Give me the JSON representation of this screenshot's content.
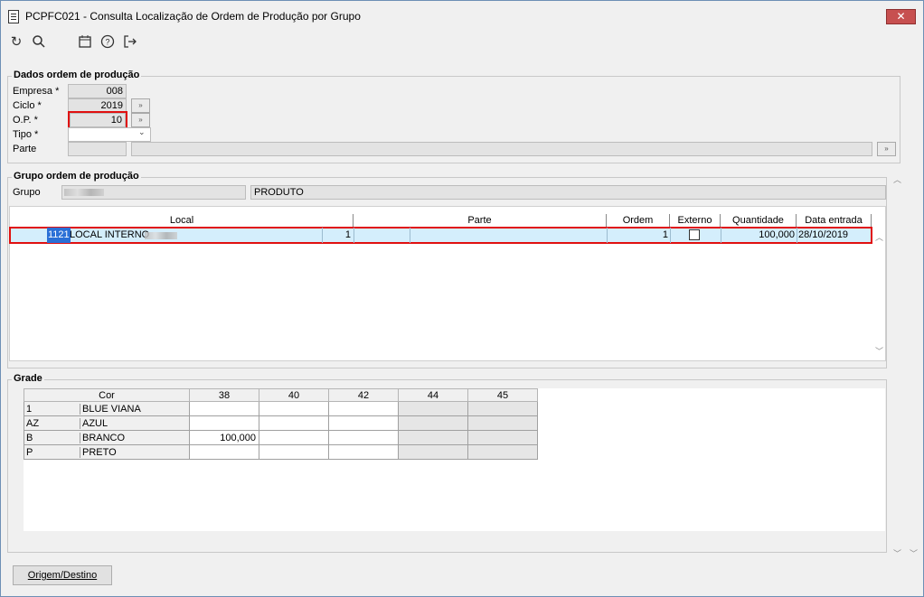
{
  "window": {
    "title": "PCPFC021 - Consulta Localização de Ordem de Produção por Grupo",
    "close_glyph": "✕"
  },
  "toolbar": {
    "refresh_glyph": "↻",
    "search_glyph": "🔍",
    "calendar_glyph": "▦",
    "help_glyph": "?",
    "exit_glyph": "⇥"
  },
  "dados": {
    "legend": "Dados ordem de produção",
    "empresa_label": "Empresa *",
    "empresa_value": "008",
    "ciclo_label": "Ciclo *",
    "ciclo_value": "2019",
    "op_label": "O.P. *",
    "op_value": "10",
    "tipo_label": "Tipo *",
    "tipo_value": "",
    "parte_label": "Parte",
    "parte_value": "",
    "parte_desc": "",
    "lookup_glyph": "»"
  },
  "grupo": {
    "legend": "Grupo ordem de produção",
    "grupo_label": "Grupo",
    "grupo_desc": "PRODUTO"
  },
  "local_grid": {
    "headers": {
      "local": "Local",
      "parte": "Parte",
      "ordem": "Ordem",
      "externo": "Externo",
      "quantidade": "Quantidade",
      "data_entrada": "Data entrada"
    },
    "rows": [
      {
        "codigo": "1121",
        "local": "LOCAL INTERNO",
        "seq": "1",
        "parte": "",
        "ordem": "1",
        "externo": false,
        "quantidade": "100,000",
        "data_entrada": "28/10/2019"
      }
    ]
  },
  "grade": {
    "legend": "Grade",
    "headers": [
      "Cor",
      "38",
      "40",
      "42",
      "44",
      "45"
    ],
    "rows": [
      {
        "code": "1",
        "name": "BLUE VIANA",
        "values": [
          "",
          "",
          "",
          "",
          ""
        ]
      },
      {
        "code": "AZ",
        "name": "AZUL",
        "values": [
          "",
          "",
          "",
          "",
          ""
        ]
      },
      {
        "code": "B",
        "name": "BRANCO",
        "values": [
          "100,000",
          "",
          "",
          "",
          ""
        ]
      },
      {
        "code": "P",
        "name": "PRETO",
        "values": [
          "",
          "",
          "",
          "",
          ""
        ]
      }
    ]
  },
  "footer": {
    "origem_destino_label": "Origem/Destino"
  }
}
